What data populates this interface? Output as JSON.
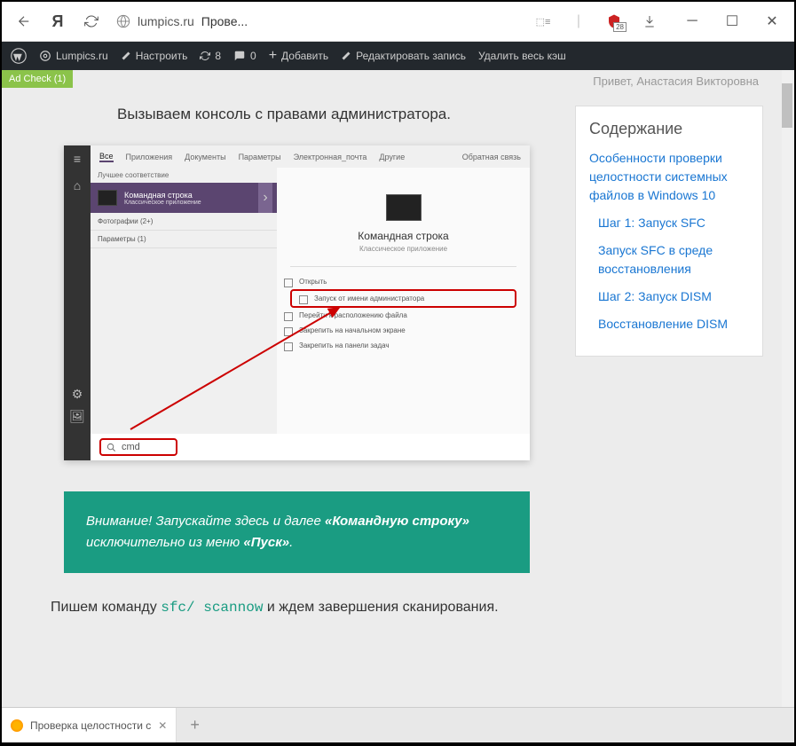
{
  "browser": {
    "domain": "lumpics.ru",
    "title_short": "Прове...",
    "shield_badge": "28"
  },
  "wpbar": {
    "site": "Lumpics.ru",
    "customize": "Настроить",
    "updates": "8",
    "comments": "0",
    "add": "Добавить",
    "edit": "Редактировать запись",
    "clear_cache": "Удалить весь кэш"
  },
  "adcheck": "Ad Check (1)",
  "greeting": "Привет, Анастасия Викторовна",
  "article": {
    "intro": "Вызываем консоль с правами администратора.",
    "callout_a": "Внимание! Запускайте здесь и далее",
    "callout_b": "«Командную строку»",
    "callout_c": "исключительно из меню",
    "callout_d": "«Пуск»",
    "cmd_pre": "Пишем команду",
    "cmd_code": "sfc/ scannow",
    "cmd_post": "и ждем завершения сканирования."
  },
  "toc": {
    "title": "Содержание",
    "l1": "Особенности проверки целостности системных файлов в Windows 10",
    "l2": "Шаг 1: Запуск SFC",
    "l3": "Запуск SFC в среде восстановления",
    "l4": "Шаг 2: Запуск DISM",
    "l5": "Восстановление DISM"
  },
  "winshot": {
    "tabs": {
      "all": "Все",
      "apps": "Приложения",
      "docs": "Документы",
      "settings": "Параметры",
      "email": "Электронная_почта",
      "other": "Другие",
      "feedback": "Обратная связь"
    },
    "best_match": "Лучшее соответствие",
    "result_title": "Командная строка",
    "result_sub": "Классическое приложение",
    "cat1": "Фотографии (2+)",
    "cat2": "Параметры (1)",
    "app_name": "Командная строка",
    "app_sub": "Классическое приложение",
    "act_open": "Открыть",
    "act_admin": "Запуск от имени администратора",
    "act_loc": "Перейти к расположению файла",
    "act_pin_start": "Закрепить на начальном экране",
    "act_pin_task": "Закрепить на панели задач",
    "search": "cmd"
  },
  "tab": {
    "title": "Проверка целостности с"
  }
}
